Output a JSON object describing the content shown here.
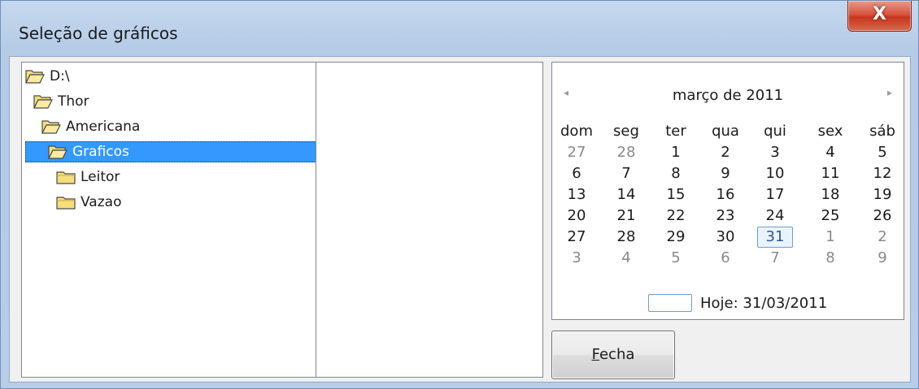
{
  "window": {
    "title": "Seleção de gráficos",
    "close_glyph": "X"
  },
  "tree": {
    "items": [
      {
        "label": "D:\\",
        "icon": "open-folder-icon"
      },
      {
        "label": "Thor",
        "icon": "open-folder-icon"
      },
      {
        "label": "Americana",
        "icon": "open-folder-icon"
      },
      {
        "label": "Graficos",
        "icon": "open-folder-icon",
        "selected": true
      },
      {
        "label": "Leitor",
        "icon": "closed-folder-icon"
      },
      {
        "label": "Vazao",
        "icon": "closed-folder-icon"
      }
    ]
  },
  "file_list": {
    "items": []
  },
  "calendar": {
    "month_title": "março de 2011",
    "prev_glyph": "◂",
    "next_glyph": "▸",
    "weekdays": [
      "dom",
      "seg",
      "ter",
      "qua",
      "qui",
      "sex",
      "sáb"
    ],
    "weeks": [
      [
        {
          "d": "27",
          "o": true
        },
        {
          "d": "28",
          "o": true
        },
        {
          "d": "1"
        },
        {
          "d": "2"
        },
        {
          "d": "3"
        },
        {
          "d": "4"
        },
        {
          "d": "5"
        }
      ],
      [
        {
          "d": "6"
        },
        {
          "d": "7"
        },
        {
          "d": "8"
        },
        {
          "d": "9"
        },
        {
          "d": "10"
        },
        {
          "d": "11"
        },
        {
          "d": "12"
        }
      ],
      [
        {
          "d": "13"
        },
        {
          "d": "14"
        },
        {
          "d": "15"
        },
        {
          "d": "16"
        },
        {
          "d": "17"
        },
        {
          "d": "18"
        },
        {
          "d": "19"
        }
      ],
      [
        {
          "d": "20"
        },
        {
          "d": "21"
        },
        {
          "d": "22"
        },
        {
          "d": "23"
        },
        {
          "d": "24"
        },
        {
          "d": "25"
        },
        {
          "d": "26"
        }
      ],
      [
        {
          "d": "27"
        },
        {
          "d": "28"
        },
        {
          "d": "29"
        },
        {
          "d": "30"
        },
        {
          "d": "31",
          "today": true
        },
        {
          "d": "1",
          "o": true
        },
        {
          "d": "2",
          "o": true
        }
      ],
      [
        {
          "d": "3",
          "o": true
        },
        {
          "d": "4",
          "o": true
        },
        {
          "d": "5",
          "o": true
        },
        {
          "d": "6",
          "o": true
        },
        {
          "d": "7",
          "o": true
        },
        {
          "d": "8",
          "o": true
        },
        {
          "d": "9",
          "o": true
        }
      ]
    ],
    "today_label": "Hoje: 31/03/2011"
  },
  "buttons": {
    "fecha_underlined": "F",
    "fecha_rest": "echa"
  },
  "colors": {
    "selection": "#3399ff",
    "folder": "#f6df7a",
    "close_button": "#c7361d"
  }
}
